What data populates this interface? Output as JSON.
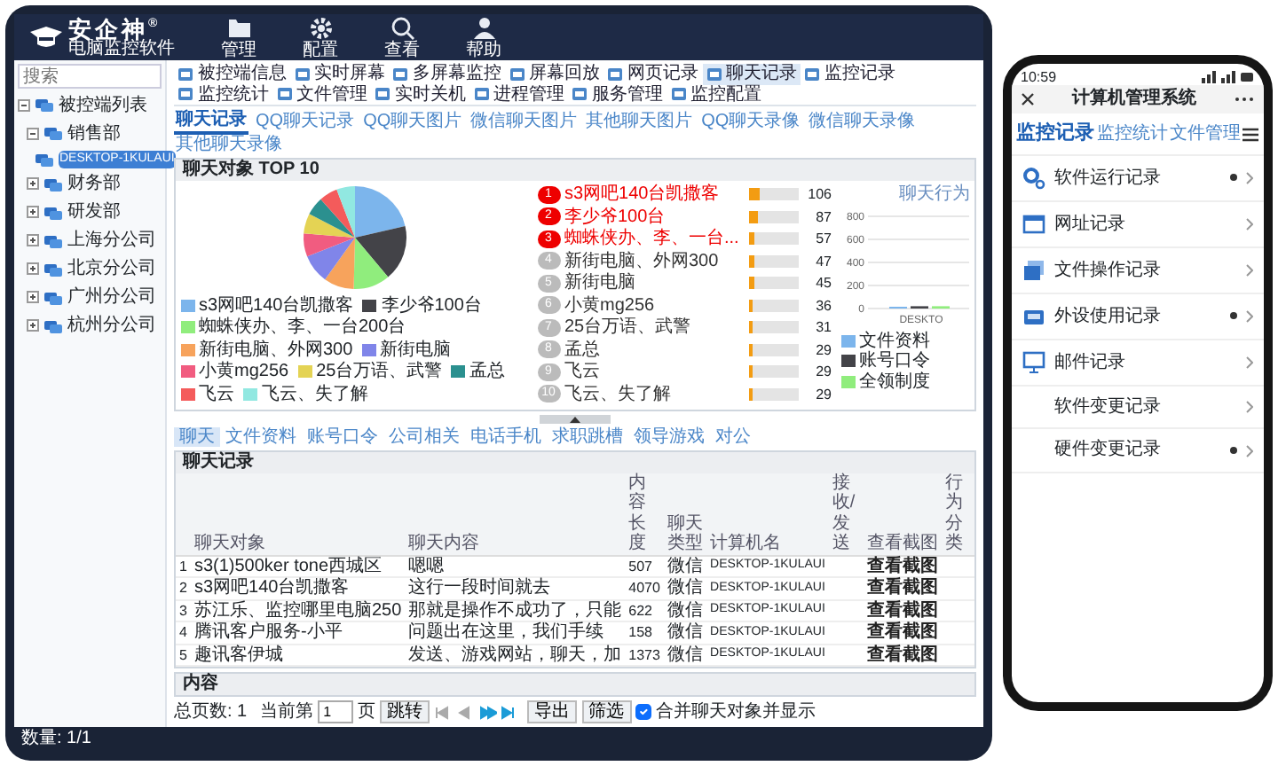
{
  "header": {
    "logo": "安企神",
    "logo_mark": "®",
    "subtitle": "电脑监控软件",
    "nav": [
      {
        "label": "管理",
        "kind": "folder"
      },
      {
        "label": "配置",
        "kind": "gear"
      },
      {
        "label": "查看",
        "kind": "search"
      },
      {
        "label": "帮助",
        "kind": "person"
      }
    ]
  },
  "sidebar": {
    "search_placeholder": "搜索",
    "tree": [
      {
        "label": "被控端列表",
        "expanded": true,
        "selected": false,
        "children": [
          {
            "label": "销售部",
            "expanded": true,
            "selected": false,
            "children": [
              {
                "label": "DESKTOP-1KULAUI",
                "selected": true
              }
            ]
          },
          {
            "label": "财务部",
            "expanded": false,
            "selected": false
          },
          {
            "label": "研发部",
            "expanded": false,
            "selected": false
          },
          {
            "label": "上海分公司",
            "expanded": false,
            "selected": false
          },
          {
            "label": "北京分公司",
            "expanded": false,
            "selected": false
          },
          {
            "label": "广州分公司",
            "expanded": false,
            "selected": false
          },
          {
            "label": "杭州分公司",
            "expanded": false,
            "selected": false
          }
        ]
      }
    ]
  },
  "toolbar": [
    {
      "label": "被控端信息",
      "selected": false
    },
    {
      "label": "实时屏幕",
      "selected": false
    },
    {
      "label": "多屏幕监控",
      "selected": false
    },
    {
      "label": "屏幕回放",
      "selected": false
    },
    {
      "label": "网页记录",
      "selected": false
    },
    {
      "label": "聊天记录",
      "selected": true
    },
    {
      "label": "监控记录",
      "selected": false
    },
    {
      "label": "监控统计",
      "selected": false
    },
    {
      "label": "文件管理",
      "selected": false
    },
    {
      "label": "实时关机",
      "selected": false
    },
    {
      "label": "进程管理",
      "selected": false
    },
    {
      "label": "服务管理",
      "selected": false
    },
    {
      "label": "监控配置",
      "selected": false
    }
  ],
  "subtabs": [
    {
      "label": "聊天记录",
      "selected": true
    },
    {
      "label": "QQ聊天记录",
      "selected": false
    },
    {
      "label": "QQ聊天图片",
      "selected": false
    },
    {
      "label": "微信聊天图片",
      "selected": false
    },
    {
      "label": "其他聊天图片",
      "selected": false
    },
    {
      "label": "QQ聊天录像",
      "selected": false
    },
    {
      "label": "微信聊天录像",
      "selected": false
    },
    {
      "label": "其他聊天录像",
      "selected": false
    }
  ],
  "top_panel": {
    "title": "聊天对象 TOP 10",
    "chart_data": {
      "type": "pie",
      "categories": [
        "s3网吧140台凯撒客",
        "李少爷100台",
        "蜘蛛侠办、李、一台200台",
        "新街电脑、外网300",
        "新街电脑",
        "小黄mg256",
        "25台万语、武警",
        "孟总",
        "飞云",
        "飞云、失了解"
      ],
      "values": [
        21.4,
        17.5,
        11.5,
        9.5,
        9.1,
        7.3,
        6.3,
        5.8,
        5.8,
        5.8
      ]
    },
    "slice_colors": [
      {
        "color": "#7cb5ec"
      },
      {
        "color": "#434348"
      },
      {
        "color": "#90ed7d"
      },
      {
        "color": "#f7a35c"
      },
      {
        "color": "#8085e9"
      },
      {
        "color": "#f15c80"
      },
      {
        "color": "#e4d354"
      },
      {
        "color": "#2b908f"
      },
      {
        "color": "#f45b5b"
      },
      {
        "color": "#91e8e1"
      }
    ],
    "ranking": [
      {
        "rank": "1",
        "name": "s3网吧140台凯撒客",
        "count": "106",
        "level": 0.21,
        "top": true
      },
      {
        "rank": "2",
        "name": "李少爷100台",
        "count": "87",
        "level": 0.17,
        "top": true
      },
      {
        "rank": "3",
        "name": "蜘蛛侠办、李、一台...",
        "count": "57",
        "level": 0.11,
        "top": true
      },
      {
        "rank": "4",
        "name": "新街电脑、外网300",
        "count": "47",
        "level": 0.09,
        "top": false
      },
      {
        "rank": "5",
        "name": "新街电脑",
        "count": "45",
        "level": 0.09,
        "top": false
      },
      {
        "rank": "6",
        "name": "小黄mg256",
        "count": "36",
        "level": 0.07,
        "top": false
      },
      {
        "rank": "7",
        "name": "25台万语、武警",
        "count": "31",
        "level": 0.06,
        "top": false
      },
      {
        "rank": "8",
        "name": "孟总",
        "count": "29",
        "level": 0.06,
        "top": false
      },
      {
        "rank": "9",
        "name": "飞云",
        "count": "29",
        "level": 0.06,
        "top": false
      },
      {
        "rank": "10",
        "name": "飞云、失了解",
        "count": "29",
        "level": 0.06,
        "top": false
      }
    ]
  },
  "behavior": {
    "title": "聊天行为",
    "chart_data": {
      "type": "bar",
      "categories": [
        "DESKTO"
      ],
      "series": [
        {
          "name": "文件资料",
          "color": "#7cb5ec",
          "values": [
            10
          ]
        },
        {
          "name": "账号口令",
          "color": "#434348",
          "values": [
            20
          ]
        },
        {
          "name": "全领制度",
          "color": "#90ed7d",
          "values": [
            20
          ]
        }
      ],
      "ylim": [
        0,
        800
      ],
      "yticks": [
        0,
        200,
        400,
        600,
        800
      ],
      "grid": true
    }
  },
  "detail_tabs": [
    {
      "label": "聊天",
      "selected": true
    },
    {
      "label": "文件资料",
      "selected": false
    },
    {
      "label": "账号口令",
      "selected": false
    },
    {
      "label": "公司相关",
      "selected": false
    },
    {
      "label": "电话手机",
      "selected": false
    },
    {
      "label": "求职跳槽",
      "selected": false
    },
    {
      "label": "领导游戏",
      "selected": false
    },
    {
      "label": "对公",
      "selected": false
    }
  ],
  "records": {
    "title": "聊天记录",
    "columns": [
      "聊天对象",
      "聊天内容",
      "内容长度",
      "聊天类型",
      "计算机名",
      "接收/发送",
      "查看截图",
      "行为分类"
    ],
    "rows": [
      {
        "index": "1",
        "contact": "s3(1)500ker tone西城区",
        "content": "嗯嗯",
        "length": "507",
        "type": "微信",
        "computer": "DESKTOP-1KULAUI",
        "screenshot": "查看截图"
      },
      {
        "index": "2",
        "contact": "s3网吧140台凯撒客",
        "content": "这行一段时间就去",
        "length": "4070",
        "type": "微信",
        "computer": "DESKTOP-1KULAUI",
        "screenshot": "查看截图"
      },
      {
        "index": "3",
        "contact": "苏江乐、监控哪里电脑250",
        "content": "那就是操作不成功了，只能",
        "length": "622",
        "type": "微信",
        "computer": "DESKTOP-1KULAUI",
        "screenshot": "查看截图"
      },
      {
        "index": "4",
        "contact": "腾讯客户服务-小平",
        "content": "问题出在这里，我们手续",
        "length": "158",
        "type": "微信",
        "computer": "DESKTOP-1KULAUI",
        "screenshot": "查看截图"
      },
      {
        "index": "5",
        "contact": "趣讯客伊城",
        "content": "发送、游戏网站，聊天，加",
        "length": "1373",
        "type": "微信",
        "computer": "DESKTOP-1KULAUI",
        "screenshot": "查看截图"
      }
    ]
  },
  "content_panel": {
    "title": "内容"
  },
  "pager": {
    "total_label": "总页数: 1",
    "current_prefix": "当前第",
    "current": "1",
    "current_suffix": "页",
    "jump": "跳转",
    "export": "导出",
    "filter": "筛选",
    "merge": {
      "label": "合并聊天对象并显示",
      "checked": true
    }
  },
  "status_bar": {
    "text": "数量: 1/1"
  },
  "phone": {
    "time": "10:59",
    "title": "计算机管理系统",
    "tabs": [
      {
        "label": "监控记录",
        "selected": true
      },
      {
        "label": "监控统计",
        "selected": false
      },
      {
        "label": "文件管理",
        "selected": false
      }
    ],
    "items": [
      {
        "label": "软件运行记录",
        "kind": "gear",
        "dot": true
      },
      {
        "label": "网址记录",
        "kind": "browser",
        "dot": false
      },
      {
        "label": "文件操作记录",
        "kind": "files",
        "dot": false
      },
      {
        "label": "外设使用记录",
        "kind": "device",
        "dot": true
      },
      {
        "label": "邮件记录",
        "kind": "monitor",
        "dot": false
      },
      {
        "label": "软件变更记录",
        "kind": "plain",
        "dot": false
      },
      {
        "label": "硬件变更记录",
        "kind": "plain",
        "dot": true
      }
    ]
  }
}
